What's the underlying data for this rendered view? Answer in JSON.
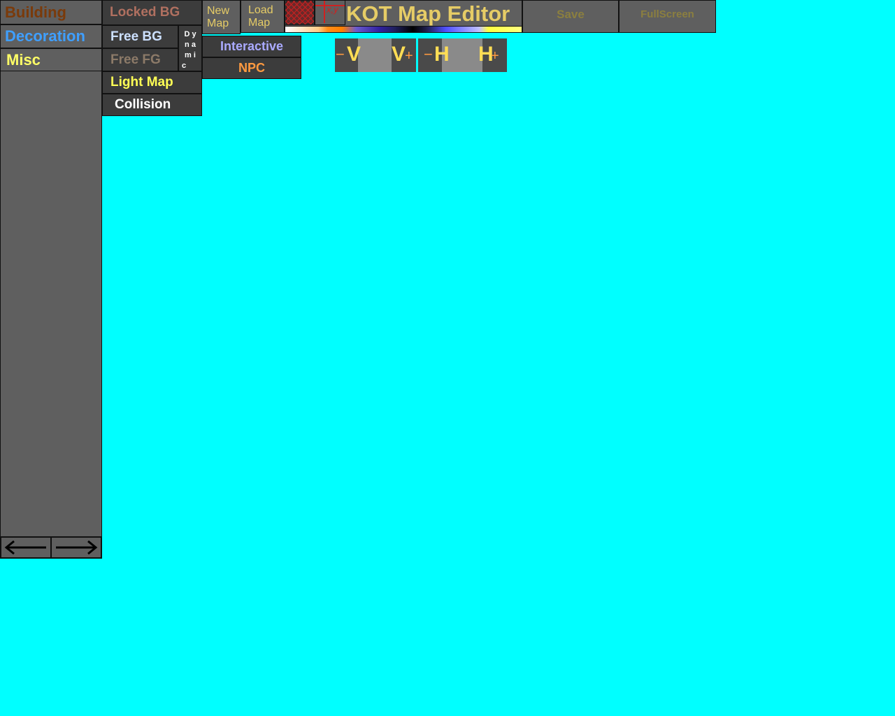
{
  "categories": {
    "building": "Building",
    "decoration": "Decoration",
    "misc": "Misc"
  },
  "layers": {
    "locked_bg": "Locked BG",
    "free_bg": "Free BG",
    "free_fg": "Free FG",
    "dynamic_chars": [
      "D y",
      "n a",
      "m i",
      "c"
    ],
    "light_map": "Light Map",
    "collision": "Collision",
    "interactive": "Interactive",
    "npc": "NPC"
  },
  "file": {
    "new_map_line1": "New",
    "new_map_line2": "Map",
    "load_map_line1": "Load",
    "load_map_line2": "Map"
  },
  "toolbar": {
    "grid_icon": "grid-icon",
    "xy_label": "x,y",
    "title": "KOT Map Editor",
    "save": "Save",
    "fullscreen": "FullScreen"
  },
  "resize": {
    "v_minus": "V",
    "v_plus": "V",
    "h_minus": "H",
    "h_plus": "H",
    "minus_sign": "−",
    "plus_sign": "+"
  },
  "colors": {
    "canvas": "#00ffff",
    "building": "#7a3a0a",
    "decoration": "#3f9fff",
    "misc": "#ffff66",
    "locked_bg": "#b07060",
    "free_bg": "#cce0ff",
    "free_fg": "#8c7a68",
    "light_map": "#ffff55",
    "collision": "#ffffff",
    "interactive": "#aaaaff",
    "npc": "#ff9a40",
    "title": "#e6cc66",
    "save": "#8b7f3f"
  }
}
